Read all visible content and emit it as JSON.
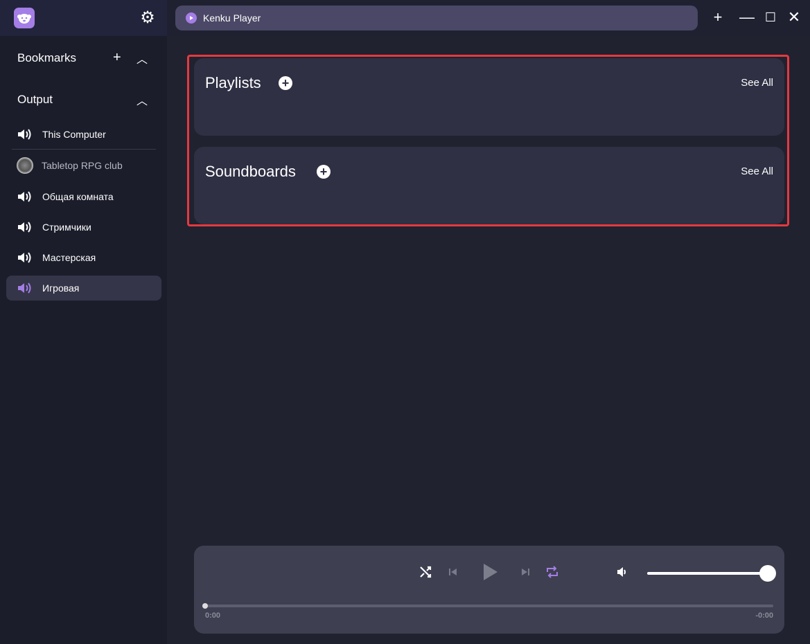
{
  "app": {
    "tab_title": "Kenku Player"
  },
  "sidebar": {
    "bookmarks_label": "Bookmarks",
    "output_label": "Output",
    "items": [
      {
        "label": "This Computer",
        "icon": "speaker-icon"
      },
      {
        "label": "Tabletop RPG club",
        "icon": "server-avatar"
      },
      {
        "label": "Общая комната",
        "icon": "speaker-icon"
      },
      {
        "label": "Стримчики",
        "icon": "speaker-icon"
      },
      {
        "label": "Мастерская",
        "icon": "speaker-icon"
      },
      {
        "label": "Игровая",
        "icon": "speaker-icon",
        "selected": true
      }
    ]
  },
  "main": {
    "playlists": {
      "title": "Playlists",
      "see_all": "See All"
    },
    "soundboards": {
      "title": "Soundboards",
      "see_all": "See All"
    }
  },
  "player": {
    "elapsed": "0:00",
    "remaining": "-0:00",
    "volume": 1.0,
    "progress": 0,
    "repeat_active": true
  },
  "colors": {
    "accent": "#a47ee6",
    "highlight": "#e5393f"
  }
}
